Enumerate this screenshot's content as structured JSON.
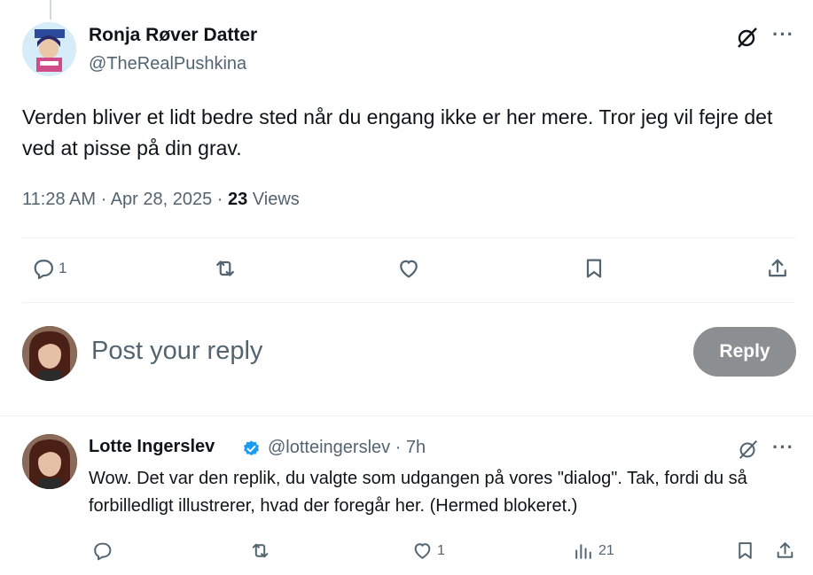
{
  "tweet": {
    "author_name": "Ronja Røver Datter",
    "author_handle": "@TheRealPushkina",
    "text": "Verden bliver et lidt bedre sted når du engang ikke er her mere. Tror jeg vil fejre det ved at pisse på din grav.",
    "time": "11:28 AM · Apr 28, 2025 · ",
    "views_count": "23",
    "views_label": " Views",
    "reply_count": "1",
    "icons": [
      "grok-icon",
      "more-icon",
      "reply-icon",
      "retweet-icon",
      "like-icon",
      "bookmark-icon",
      "share-icon"
    ]
  },
  "composer": {
    "placeholder": "Post your reply",
    "reply_button": "Reply"
  },
  "reply": {
    "author_name": "Lotte Ingerslev",
    "author_handle": "@lotteingerslev · 7h",
    "verified": true,
    "text": "Wow. Det var den replik, du valgte som udgangen på vores \"dialog\". Tak, fordi du så forbilledligt illustrerer, hvad der foregår her. (Hermed blokeret.)",
    "like_count": "1",
    "view_count": "21"
  },
  "colors": {
    "text": "#0f1419",
    "secondary": "#536471",
    "reply_button_bg": "#8c8f92",
    "verified": "#1d9bf0"
  }
}
